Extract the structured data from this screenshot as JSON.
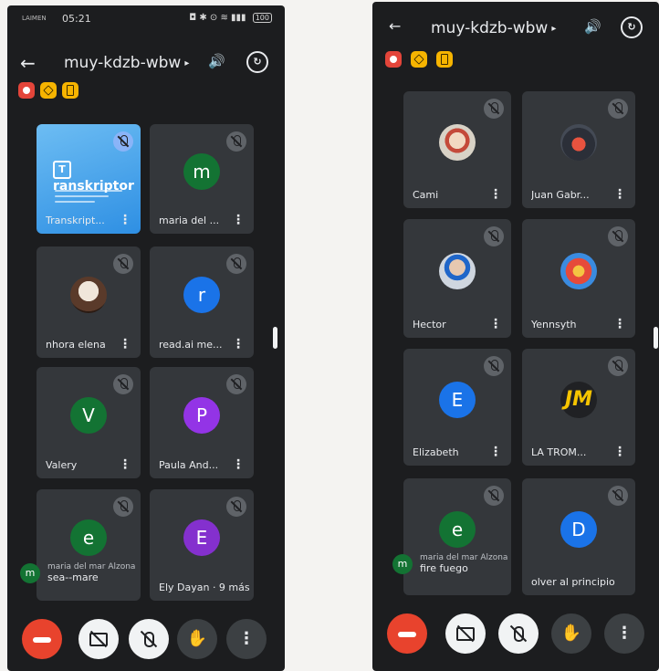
{
  "left": {
    "status": {
      "carrier": "LAIMEN",
      "time": "05:21",
      "right_icons": "◘ ✱ ⊙ ≋ ▮▮▮",
      "battery": "100"
    },
    "title": "muy-kdzb-wbw",
    "tiles": [
      {
        "name": "Transkript...",
        "logo": "ranskriptor",
        "logo_mark": "T"
      },
      {
        "name": "maria del ...",
        "initial": "m",
        "color": "#137333"
      },
      {
        "name": "nhora elena"
      },
      {
        "name": "read.ai me...",
        "initial": "r",
        "color": "#1a73e8"
      },
      {
        "name": "Valery",
        "initial": "V",
        "color": "#137333"
      },
      {
        "name": "Paula And...",
        "initial": "P",
        "color": "#9334e6"
      },
      {
        "name": "",
        "initial": "e",
        "color": "#137333"
      },
      {
        "name": "Ely Dayan · 9 más",
        "initial": "E",
        "color": "#8430ce"
      }
    ],
    "bubble": {
      "initial": "m",
      "line1": "maria del mar Alzona",
      "line2": "sea--mare"
    }
  },
  "right": {
    "title": "muy-kdzb-wbw",
    "tiles": [
      {
        "name": "Cami"
      },
      {
        "name": "Juan Gabr..."
      },
      {
        "name": "Hector"
      },
      {
        "name": "Yennsyth"
      },
      {
        "name": "Elizabeth",
        "initial": "E",
        "color": "#1a73e8"
      },
      {
        "name": "LA TROM...",
        "initial": "JM",
        "color": "#202124"
      },
      {
        "name": "",
        "initial": "e",
        "color": "#137333"
      },
      {
        "name": "olver al principio",
        "initial": "D",
        "color": "#1a73e8"
      }
    ],
    "bubble": {
      "initial": "m",
      "line1": "maria del mar Alzona",
      "line2": "fire fuego"
    }
  },
  "icons": {
    "back": "back-arrow-icon",
    "speaker": "speaker-icon",
    "switch_camera": "switch-camera-icon",
    "mic_off": "mic-off-icon",
    "more": "more-vert-icon",
    "end_call": "end-call-icon",
    "camera_off": "camera-off-icon",
    "hand": "raise-hand-icon"
  },
  "glyphs": {
    "back": "←",
    "chev": "▸",
    "speaker": "🔊",
    "switch": "↻",
    "more": "⋮",
    "hand": "✋"
  }
}
